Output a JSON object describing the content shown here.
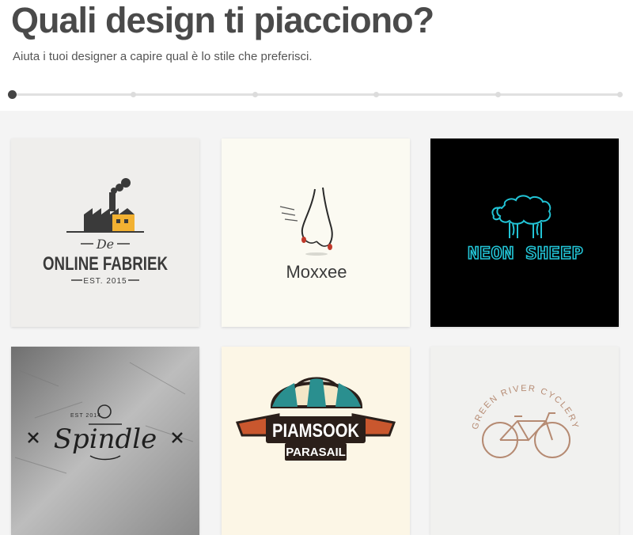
{
  "header": {
    "title": "Quali design ti piacciono?",
    "subtitle": "Aiuta i tuoi designer a capire qual è lo stile che preferisci."
  },
  "progress": {
    "steps": 6,
    "current_step": 1
  },
  "logos": [
    {
      "line1": "De",
      "line2": "ONLINE FABRIEK",
      "line3": "EST. 2015",
      "icon": "factory-icon"
    },
    {
      "name": "Moxxee",
      "icon": "hand-icon"
    },
    {
      "name": "NEON SHEEP",
      "icon": "sheep-icon",
      "accent": "#22c4d6"
    },
    {
      "top_text": "EST 2014",
      "name": "Spindle",
      "icon": "spindle-icon"
    },
    {
      "name": "PIAMSOOK",
      "sub": "PARASAIL",
      "icon": "parasail-icon"
    },
    {
      "name": "GREEN RIVER CYCLERY",
      "icon": "bicycle-icon"
    }
  ]
}
